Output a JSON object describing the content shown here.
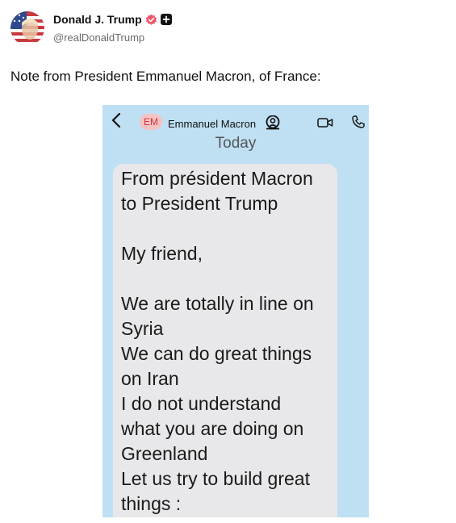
{
  "post": {
    "author_name": "Donald J. Trump",
    "handle": "@realDonaldTrump",
    "text": "Note from President Emmanuel Macron, of France:"
  },
  "screenshot": {
    "contact_initials": "EM",
    "contact_name": "Emmanuel Macron",
    "date_label": "Today",
    "message": "From président Macron\nto President Trump\n\nMy friend,\n\nWe are totally in line on\nSyria\nWe can do great things\non Iran\nI do not understand\nwhat you are doing on\nGreenland\nLet us try to build great\nthings :"
  },
  "icons": {
    "verified": "verified-badge-icon",
    "plus": "plus-badge-icon",
    "back": "chevron-left-icon",
    "people": "people-icon",
    "video": "video-icon",
    "phone": "phone-icon"
  },
  "colors": {
    "verified": "#f0576b",
    "screenshot_bg": "#bfe0f3",
    "bubble_bg": "#e8e8ea",
    "initials_bg": "#f6c2c4",
    "initials_text": "#d0343b"
  }
}
